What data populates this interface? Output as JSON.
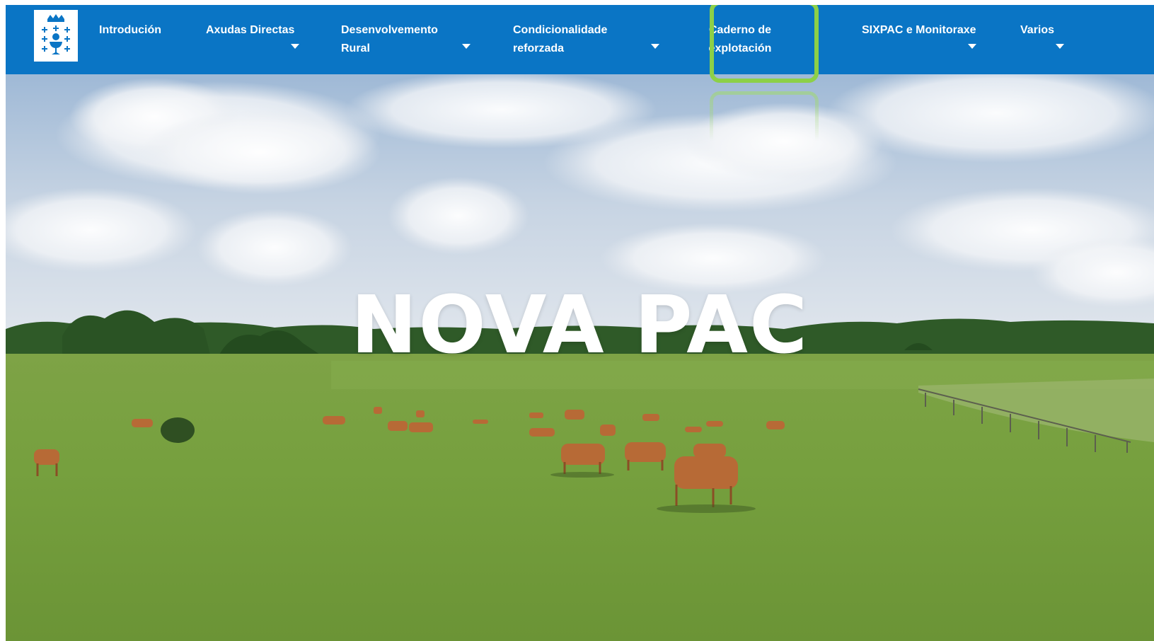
{
  "nav": {
    "items": [
      {
        "label": "Introdución",
        "has_dropdown": false
      },
      {
        "label": "Axudas Directas",
        "has_dropdown": true
      },
      {
        "label": "Desenvolvemento\nRural",
        "has_dropdown": true
      },
      {
        "label": "Condicionalidade\nreforzada",
        "has_dropdown": true
      },
      {
        "label": "Caderno de\nexplotación",
        "has_dropdown": false,
        "highlighted": true
      },
      {
        "label": "SIXPAC e Monitoraxe",
        "has_dropdown": true
      },
      {
        "label": "Varios",
        "has_dropdown": true
      }
    ]
  },
  "hero": {
    "title": "NOVA PAC"
  },
  "colors": {
    "nav_background": "#0a75c5",
    "highlight": "#8cd048",
    "text": "#ffffff"
  },
  "icons": {
    "logo": "xunta-de-galicia-shield-icon",
    "dropdown": "caret-down-icon"
  }
}
